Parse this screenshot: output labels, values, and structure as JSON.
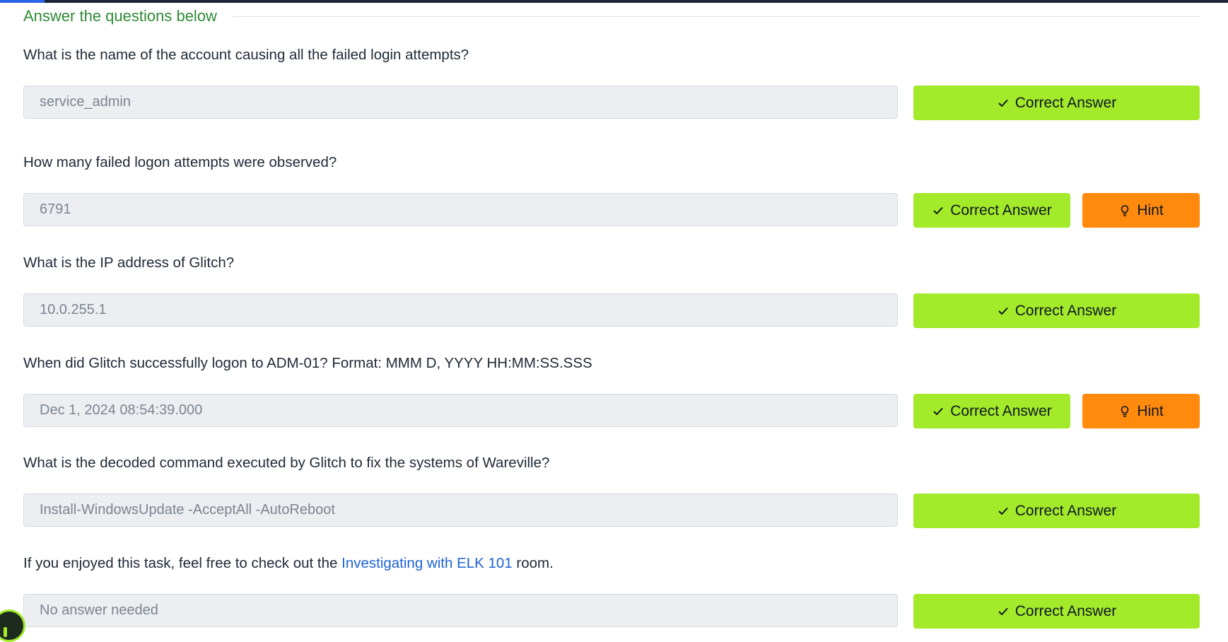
{
  "page": {
    "section_title": "Answer the questions below",
    "progress_fraction": 0.036
  },
  "questions": [
    {
      "text": "What is the name of the account causing all the failed login attempts?",
      "answer": "service_admin",
      "correct_label": "Correct Answer",
      "has_hint": false
    },
    {
      "text": "How many failed logon attempts were observed?",
      "answer": "6791",
      "correct_label": "Correct Answer",
      "has_hint": true,
      "hint_label": "Hint"
    },
    {
      "text": "What is the IP address of Glitch?",
      "answer": "10.0.255.1",
      "correct_label": "Correct Answer",
      "has_hint": false
    },
    {
      "text": "When did Glitch successfully logon to ADM-01? Format: MMM D, YYYY HH:MM:SS.SSS",
      "answer": "Dec 1, 2024 08:54:39.000",
      "correct_label": "Correct Answer",
      "has_hint": true,
      "hint_label": "Hint"
    },
    {
      "text": "What is the decoded command executed by Glitch to fix the systems of Wareville?",
      "answer": "Install-WindowsUpdate -AcceptAll -AutoReboot",
      "correct_label": "Correct Answer",
      "has_hint": false
    },
    {
      "text_before": "If you enjoyed this task, feel free to check out the ",
      "link_text": "Investigating with ELK 101",
      "text_after": " room.",
      "answer": "No answer needed",
      "correct_label": "Correct Answer",
      "has_hint": false
    }
  ],
  "icons": {
    "check": "check-icon",
    "hint": "lightbulb-icon"
  },
  "colors": {
    "section_title": "#2f8a35",
    "correct_button": "#a3ea2a",
    "hint_button": "#ff8a0e",
    "link": "#1f63d6",
    "topbar": "#1c2538",
    "progress": "#2b63e6"
  }
}
